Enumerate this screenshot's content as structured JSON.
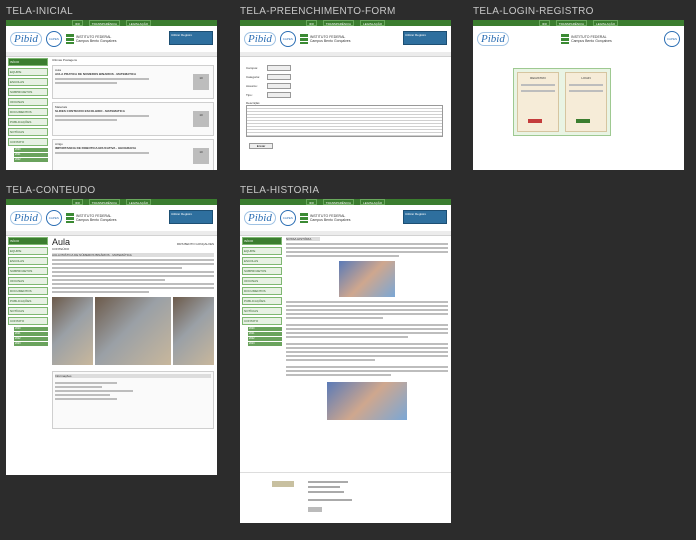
{
  "frames": [
    {
      "key": "inicial",
      "label": "TELA-INICIAL"
    },
    {
      "key": "preenchimento",
      "label": "TELA-PREENCHIMENTO-FORM"
    },
    {
      "key": "login",
      "label": "TELA-LOGIN-REGISTRO"
    },
    {
      "key": "conteudo",
      "label": "TELA-CONTEUDO"
    },
    {
      "key": "historia",
      "label": "TELA-HISTORIA"
    }
  ],
  "brand": {
    "pibid": "Pibid",
    "capes": "CAPES",
    "institute": "INSTITUTO FEDERAL",
    "campus": "Campus Bento Gonçalves"
  },
  "topbar": [
    "IFR",
    "TRANSPARÊNCIA",
    "LEGISLAÇÃO"
  ],
  "search_label": "Utilizar Registro",
  "sidebar": [
    "INÍCIO",
    "EQUIPE",
    "ESCOLAS",
    "SUBPROJETOS",
    "OFICINAS",
    "DOCUMENTOS",
    "PUBLICAÇÕES",
    "NOTÍCIAS",
    "CONTATO"
  ],
  "sub_items": [
    "2020",
    "2021",
    "2022",
    "2023"
  ],
  "inicial": {
    "filter": "Ultimas Postagens",
    "posts": [
      {
        "tag": "Aula",
        "title": "AULA PRATICA DE NUMEROS BINARIOS - MATEMATICA",
        "count": "10"
      },
      {
        "tag": "Materiais",
        "title": "SLIDES CONTEUDO ESCOLHIDO - MATEMATICA",
        "count": "10"
      },
      {
        "tag": "Artigo",
        "title": "IMPORTANCIA DE ROBOTICA EDUCATIVA - GEOGRAFIA",
        "count": "10"
      }
    ]
  },
  "preenchimento": {
    "fields": [
      "Campus:",
      "Categoria:",
      "Assunto:",
      "Tipo:"
    ],
    "desc_label": "Descrição:",
    "submit": "Enviar"
  },
  "login": {
    "register": "REGISTRO",
    "login": "LOGIN"
  },
  "conteudo": {
    "title": "Aula",
    "subtitle": "CONTEÚDO",
    "campus_label": "IFRS BENTO GONÇALVES",
    "topic": "AULA PRÁTICA DE NÚMEROS BINÁRIOS - MATEMÁTICA",
    "info": "Informações"
  },
  "historia": {
    "heading": "NOSSA HISTÓRIA"
  }
}
